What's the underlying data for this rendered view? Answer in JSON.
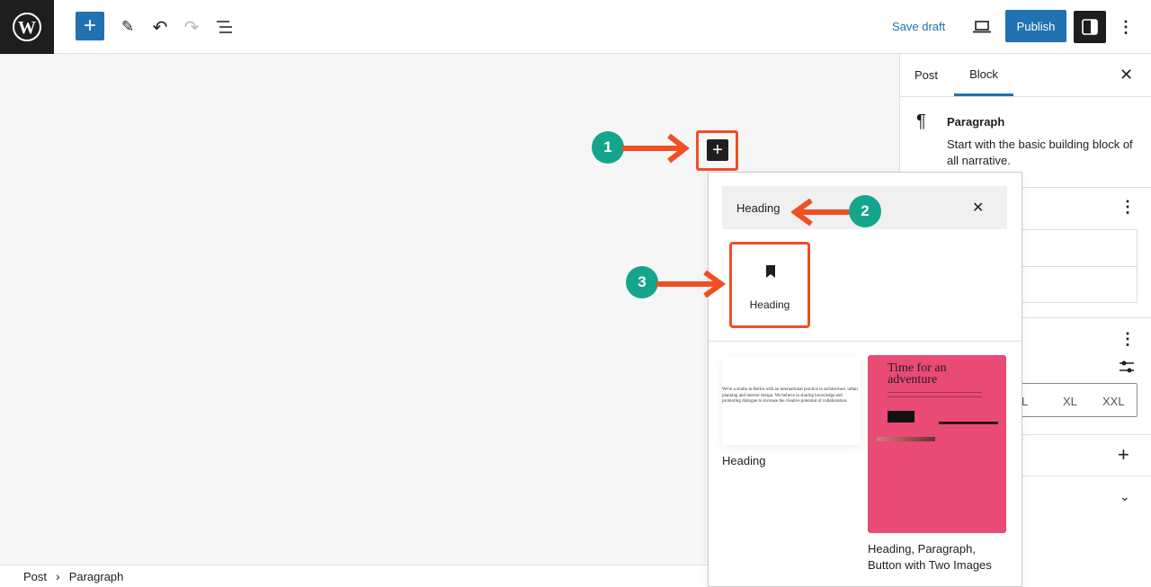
{
  "toolbar": {
    "save_draft": "Save draft",
    "publish": "Publish"
  },
  "sidebar": {
    "tabs": [
      {
        "label": "Post"
      },
      {
        "label": "Block",
        "active": true
      }
    ],
    "block_name": "Paragraph",
    "block_description": "Start with the basic building block of all narrative.",
    "sizes": [
      "L",
      "XL",
      "XXL"
    ]
  },
  "inserter": {
    "search_value": "Heading",
    "block_result": {
      "label": "Heading",
      "icon": "bookmark-icon"
    },
    "patterns": [
      {
        "label": "Heading",
        "preview_text": "We're a studio in Berlin with an international practice in architecture, urban planning and interior design. We believe in sharing knowledge and promoting dialogue to increase the creative potential of collaboration."
      },
      {
        "label": "Heading, Paragraph, Button with Two Images",
        "preview_title": "Time for an adventure",
        "preview_color": "#e94b75"
      }
    ]
  },
  "annotations": [
    "1",
    "2",
    "3"
  ],
  "breadcrumb": [
    "Post",
    "Paragraph"
  ],
  "colors": {
    "accent": "#2271b1",
    "annotation_arrow": "#f04e23",
    "annotation_circle": "#15a58c"
  }
}
